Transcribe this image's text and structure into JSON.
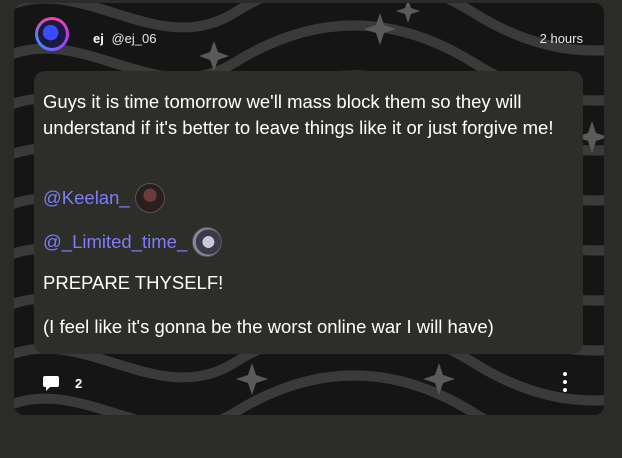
{
  "post": {
    "author_name": "ej",
    "author_handle": "@ej_06",
    "timestamp": "2 hours",
    "body": "Guys it is time tomorrow we'll mass block them so they will understand if it's better to leave things like it or just forgive me!",
    "mentions": [
      {
        "handle": "@Keelan_"
      },
      {
        "handle": "@_Limited_time_"
      }
    ],
    "line_1": "PREPARE THYSELF!",
    "line_2": "(I feel like it's gonna be the worst online war I will have)"
  },
  "footer": {
    "comment_count": "2"
  },
  "icons": {
    "comment": "comment-bubble-icon",
    "more": "more-vertical-icon"
  },
  "colors": {
    "mention": "#7d7dfa",
    "bubble": "#2d2d2a",
    "page": "#2b2b27"
  }
}
